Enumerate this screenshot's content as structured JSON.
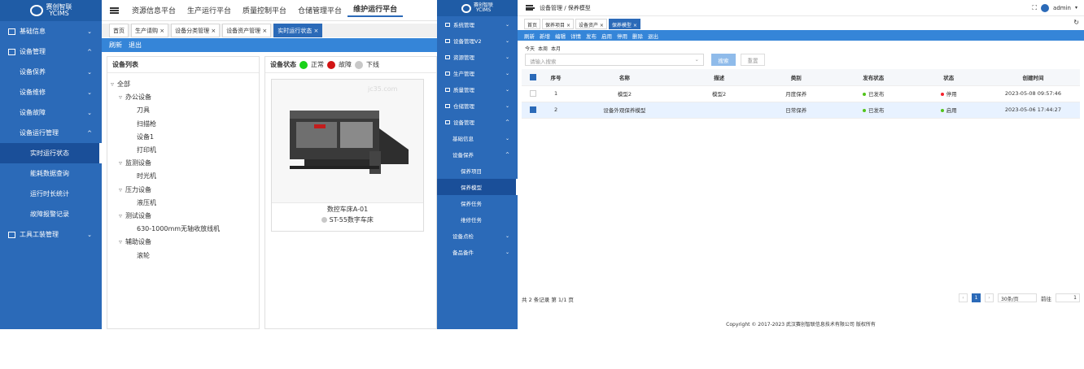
{
  "left": {
    "logo": {
      "top": "赛创智联",
      "bottom": "YCIMS"
    },
    "sidebar": [
      {
        "label": "基础信息",
        "level": 0,
        "chev": "⌄"
      },
      {
        "label": "设备管理",
        "level": 0,
        "chev": "^"
      },
      {
        "label": "设备保养",
        "level": 1,
        "chev": "⌄"
      },
      {
        "label": "设备维修",
        "level": 1,
        "chev": "⌄"
      },
      {
        "label": "设备故障",
        "level": 1,
        "chev": "⌄"
      },
      {
        "label": "设备运行管理",
        "level": 1,
        "chev": "^"
      },
      {
        "label": "实时运行状态",
        "level": 2,
        "active": true
      },
      {
        "label": "能耗数据查询",
        "level": 2
      },
      {
        "label": "运行时长统计",
        "level": 2
      },
      {
        "label": "故障报警记录",
        "level": 2
      },
      {
        "label": "工具工装管理",
        "level": 0,
        "chev": "⌄"
      }
    ],
    "platforms": [
      "资源信息平台",
      "生产运行平台",
      "质量控制平台",
      "仓储管理平台",
      "维护运行平台"
    ],
    "active_platform": "维护运行平台",
    "tabs": [
      {
        "label": "首页",
        "close": false
      },
      {
        "label": "生产请购",
        "close": true
      },
      {
        "label": "设备分类管理",
        "close": true
      },
      {
        "label": "设备资产管理",
        "close": true
      },
      {
        "label": "实时运行状态",
        "close": true,
        "active": true
      }
    ],
    "toolbar": {
      "refresh": "刷新",
      "exit": "退出"
    },
    "device_list": {
      "title": "设备列表",
      "tree": [
        {
          "label": "全部",
          "level": 0,
          "toggle": "▿"
        },
        {
          "label": "办公设备",
          "level": 1,
          "toggle": "▿"
        },
        {
          "label": "刀具",
          "level": 2
        },
        {
          "label": "扫描枪",
          "level": 2
        },
        {
          "label": "设备1",
          "level": 2
        },
        {
          "label": "打印机",
          "level": 2
        },
        {
          "label": "监测设备",
          "level": 1,
          "toggle": "▿"
        },
        {
          "label": "时光机",
          "level": 2
        },
        {
          "label": "压力设备",
          "level": 1,
          "toggle": "▿"
        },
        {
          "label": "液压机",
          "level": 2
        },
        {
          "label": "测试设备",
          "level": 1,
          "toggle": "▿"
        },
        {
          "label": "630-1000mm无轴收放线机",
          "level": 2
        },
        {
          "label": "辅助设备",
          "level": 1,
          "toggle": "▿"
        },
        {
          "label": "滚轮",
          "level": 2
        }
      ]
    },
    "status": {
      "label": "设备状态",
      "legend": [
        {
          "label": "正常",
          "color": "#19d219"
        },
        {
          "label": "故障",
          "color": "#d21414"
        },
        {
          "label": "下线",
          "color": "#c8c8c8"
        }
      ]
    },
    "device": {
      "name": "数控车床A-01",
      "model": "ST-55数字车床",
      "watermark": "jc35.com"
    }
  },
  "right": {
    "logo": {
      "top": "赛创智联",
      "bottom": "YCIMS"
    },
    "sidebar": [
      {
        "label": "系统管理",
        "level": 0,
        "chev": "⌄"
      },
      {
        "label": "设备管理V2",
        "level": 0,
        "chev": "⌄"
      },
      {
        "label": "资源管理",
        "level": 0,
        "chev": "⌄"
      },
      {
        "label": "生产管理",
        "level": 0,
        "chev": "⌄"
      },
      {
        "label": "质量管理",
        "level": 0,
        "chev": "⌄"
      },
      {
        "label": "仓储管理",
        "level": 0,
        "chev": "⌄"
      },
      {
        "label": "设备管理",
        "level": 0,
        "chev": "^"
      },
      {
        "label": "基础信息",
        "level": 1,
        "chev": "⌄"
      },
      {
        "label": "设备保养",
        "level": 1,
        "chev": "^"
      },
      {
        "label": "保养项目",
        "level": 2
      },
      {
        "label": "保养模型",
        "level": 2,
        "active": true
      },
      {
        "label": "保养任务",
        "level": 2
      },
      {
        "label": "维修任务",
        "level": 2
      },
      {
        "label": "设备点检",
        "level": 1,
        "chev": "⌄"
      },
      {
        "label": "备品备件",
        "level": 1,
        "chev": "⌄"
      }
    ],
    "breadcrumb": "设备管理  /  保养模型",
    "user": "admin",
    "tabs": [
      {
        "label": "首页",
        "close": false
      },
      {
        "label": "保养项目",
        "close": true
      },
      {
        "label": "设备资产",
        "close": true
      },
      {
        "label": "保养模型",
        "close": true,
        "active": true
      }
    ],
    "toolbar": [
      "刷新",
      "新增",
      "编辑",
      "详情",
      "发布",
      "启用",
      "停用",
      "删除",
      "退出"
    ],
    "quick_filters": [
      "今天",
      "本周",
      "本月"
    ],
    "search_placeholder": "请输入搜索",
    "search_btn": "搜索",
    "reset_btn": "重置",
    "columns": [
      "序号",
      "名称",
      "描述",
      "类别",
      "发布状态",
      "状态",
      "创建时间"
    ],
    "rows": [
      {
        "no": "1",
        "name": "模型2",
        "desc": "模型2",
        "cat": "月度保养",
        "pub": "已发布",
        "pub_color": "#52c41a",
        "status": "停用",
        "status_color": "#f5222d",
        "time": "2023-05-08 09:57:46",
        "selected": false
      },
      {
        "no": "2",
        "name": "设备外观保养模型",
        "desc": "",
        "cat": "日常保养",
        "pub": "已发布",
        "pub_color": "#52c41a",
        "status": "启用",
        "status_color": "#52c41a",
        "time": "2023-05-06 17:44:27",
        "selected": true
      }
    ],
    "pager": {
      "total": "共 2 条记录 第 1/1 页",
      "page": "1",
      "size": "30条/页",
      "goto": "前往",
      "goto_val": "1"
    },
    "copyright": "Copyright © 2017-2023 武汉赛创智联信息技术有限公司 版权所有"
  }
}
